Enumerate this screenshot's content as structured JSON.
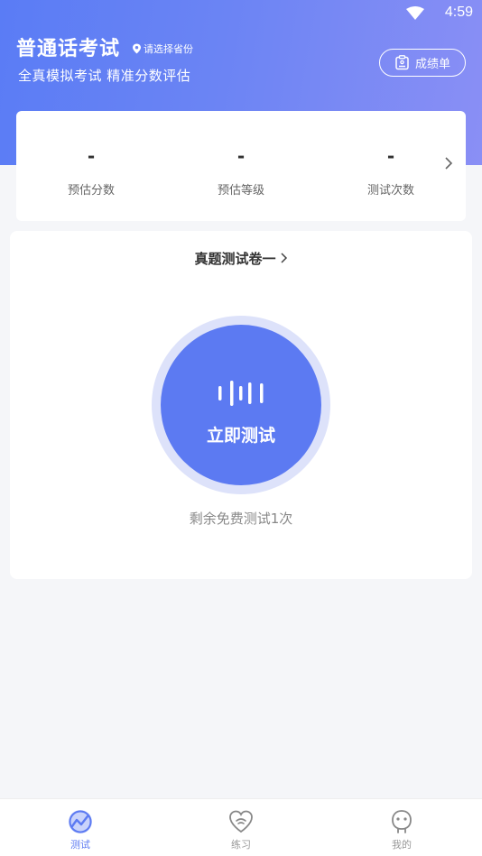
{
  "status_bar": {
    "time": "4:59"
  },
  "header": {
    "title": "普通话考试",
    "location_label": "请选择省份",
    "subtitle": "全真模拟考试 精准分数评估",
    "report_button": "成绩单"
  },
  "stats": [
    {
      "value": "-",
      "label": "预估分数"
    },
    {
      "value": "-",
      "label": "预估等级"
    },
    {
      "value": "-",
      "label": "测试次数"
    }
  ],
  "test": {
    "paper_title": "真题测试卷一",
    "start_label": "立即测试",
    "remaining_text": "剩余免费测试1次"
  },
  "tabbar": {
    "items": [
      {
        "label": "测试",
        "icon": "test-icon",
        "active": true
      },
      {
        "label": "练习",
        "icon": "practice-icon",
        "active": false
      },
      {
        "label": "我的",
        "icon": "profile-icon",
        "active": false
      }
    ]
  },
  "colors": {
    "accent": "#5c7af2",
    "header_start": "#5a7cf5",
    "header_end": "#8a8ff5"
  }
}
